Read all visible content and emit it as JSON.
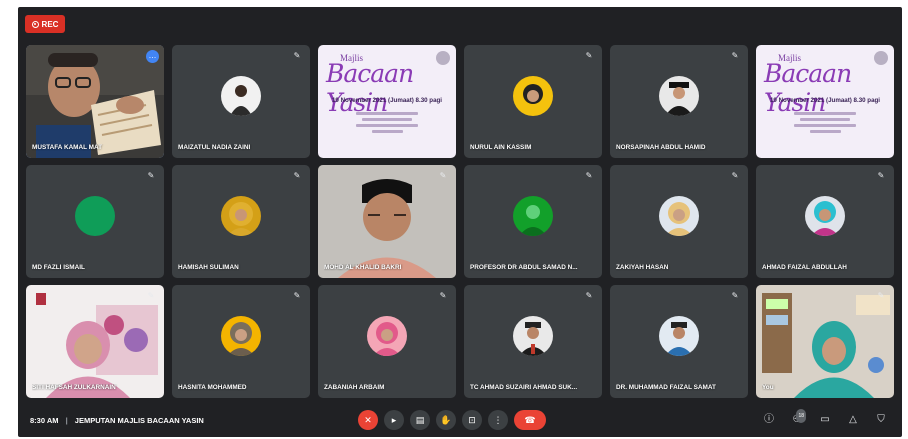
{
  "recording": {
    "label": "REC",
    "color": "#d93025"
  },
  "meeting": {
    "time": "8:30 AM",
    "separator": "|",
    "title": "JEMPUTAN MAJLIS BACAAN YASIN"
  },
  "poster": {
    "line1": "Majlis",
    "line2": "Bacaan Yasin",
    "date": "19 November 2021 (Jumaat) 8.30 pagi"
  },
  "participants": [
    {
      "name": "MUSTAFA KAMAL MAT"
    },
    {
      "name": "MAIZATUL NADIA ZAINI"
    },
    {
      "name": ""
    },
    {
      "name": "NURUL AIN KASSIM"
    },
    {
      "name": "NORSAPINAH ABDUL HAMID"
    },
    {
      "name": ""
    },
    {
      "name": "MD FAZLI ISMAIL"
    },
    {
      "name": "HAMISAH SULIMAN"
    },
    {
      "name": "MOHD AL KHALID BAKRI"
    },
    {
      "name": "PROFESOR DR ABDUL SAMAD N..."
    },
    {
      "name": "ZAKIYAH HASAN"
    },
    {
      "name": "AHMAD FAIZAL ABDULLAH"
    },
    {
      "name": "SITI HAFSAH ZULKARNAIN"
    },
    {
      "name": "HASNITA MOHAMMED"
    },
    {
      "name": "ZABANIAH ARBAIM"
    },
    {
      "name": "TC AHMAD SUZAIRI AHMAD SUK..."
    },
    {
      "name": "DR. MUHAMMAD FAIZAL SAMAT"
    },
    {
      "name": "You"
    }
  ],
  "controls": {
    "mic": "mic-off-icon",
    "camera": "camera-off-icon",
    "captions": "captions-icon",
    "raise_hand": "hand-icon",
    "present": "present-icon",
    "more": "more-icon",
    "leave": "hangup-icon"
  },
  "right_controls": {
    "people_count": "18"
  },
  "colors": {
    "background": "#202124",
    "tile": "#3c4043",
    "accent": "#8ab4f8",
    "danger": "#ea4335"
  }
}
